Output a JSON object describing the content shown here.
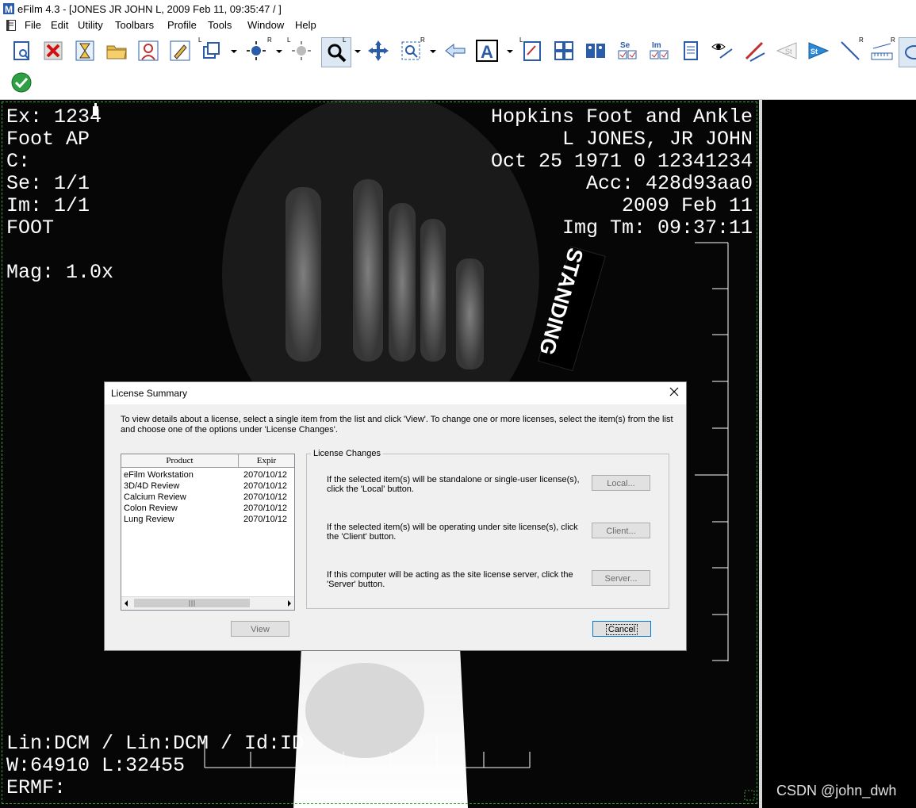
{
  "window": {
    "title": "eFilm 4.3 - [JONES JR JOHN L, 2009 Feb 11, 09:35:47  /  ]"
  },
  "menu": [
    "File",
    "Edit",
    "Utility",
    "Toolbars",
    "Profile",
    "Tools",
    "Window",
    "Help"
  ],
  "toolbar": {
    "se_label": "Se",
    "im_label": "Im",
    "st_label": "St",
    "flag_l": "L",
    "flag_r": "R"
  },
  "overlay": {
    "top_left": [
      "Ex: 1234",
      "Foot AP",
      "C:",
      "Se: 1/1",
      "Im: 1/1",
      "FOOT",
      "",
      "Mag: 1.0x"
    ],
    "top_right": [
      "Hopkins Foot and Ankle",
      "L JONES, JR JOHN",
      "Oct 25 1971 0 12341234",
      "Acc: 428d93aa0",
      "2009 Feb 11",
      "Img Tm: 09:37:11"
    ],
    "bottom_left": [
      "Lin:DCM / Lin:DCM / Id:ID",
      "W:64910  L:32455",
      "ERMF:"
    ],
    "marker_text": "STANDING"
  },
  "dialog": {
    "title": "License Summary",
    "description": "To view details about a license, select a single item from the list and click 'View'.  To change one or more licenses, select the item(s) from the list and choose one of the options under 'License Changes'.",
    "columns": [
      "Product",
      "Expir"
    ],
    "licenses": [
      {
        "product": "eFilm Workstation",
        "expires": "2070/10/12"
      },
      {
        "product": "3D/4D Review",
        "expires": "2070/10/12"
      },
      {
        "product": "Calcium Review",
        "expires": "2070/10/12"
      },
      {
        "product": "Colon Review",
        "expires": "2070/10/12"
      },
      {
        "product": "Lung Review",
        "expires": "2070/10/12"
      }
    ],
    "group_label": "License Changes",
    "local_text": "If the selected item(s) will be standalone or single-user license(s), click the 'Local' button.",
    "local_button": "Local...",
    "client_text": "If the selected item(s) will be operating under site license(s), click the 'Client' button.",
    "client_button": "Client...",
    "server_text": "If this computer will be acting as the site license server, click the 'Server' button.",
    "server_button": "Server...",
    "view_button": "View",
    "cancel_button": "Cancel"
  },
  "watermark": "CSDN @john_dwh"
}
